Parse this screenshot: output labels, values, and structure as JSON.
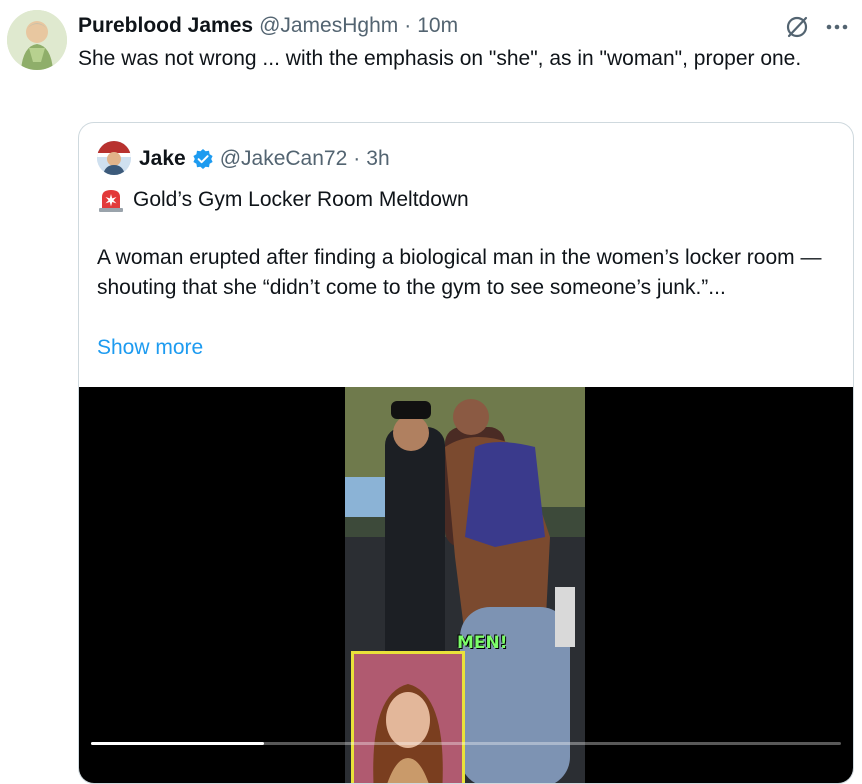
{
  "post": {
    "author_name": "Pureblood James",
    "author_handle": "@JamesHghm",
    "separator": "·",
    "time": "10m",
    "text": "She was not wrong ... with the emphasis on \"she\", as in \"woman\", proper one.",
    "avatar_icon": "avatar-illustration-icon",
    "grok_icon": "grok-slash-circle-icon",
    "more_icon": "more-dots-icon"
  },
  "quote": {
    "author_name": "Jake",
    "author_handle": "@JakeCan72",
    "separator": "·",
    "time": "3h",
    "verified_icon": "verified-badge-icon",
    "verified_color": "#1d9bf0",
    "title_emoji": "police-light-icon",
    "title": "Gold’s Gym Locker Room Meltdown",
    "body": "A woman erupted after finding a biological man in the women’s locker room — shouting that she “didn’t come to the gym to see someone’s junk.”...",
    "show_more": "Show more"
  },
  "media": {
    "overlay_caption": "MEN!",
    "progress_fraction": 0.23
  },
  "colors": {
    "link": "#1d9bf0",
    "secondary_text": "#536471",
    "border": "#cfd9de"
  }
}
